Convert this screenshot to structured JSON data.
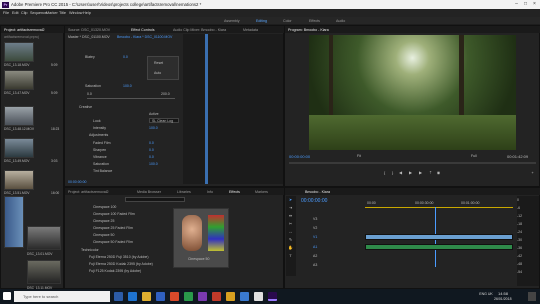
{
  "window": {
    "title": "Adobe Premiere Pro CC 2015 - C:\\Users\\user\\Videos\\projects college\\artifactsremoval\\nemations2 *"
  },
  "menu": [
    "File",
    "Edit",
    "Clip",
    "Sequence",
    "Marker",
    "Title",
    "Window",
    "Help"
  ],
  "workspaces": {
    "items": [
      "Assembly",
      "Editing",
      "Color",
      "Effects",
      "Audio"
    ],
    "active": "Editing"
  },
  "project": {
    "tab": "Project: artifactsremoval2",
    "tabs2": [
      "Media Br",
      "Info",
      "Libr"
    ],
    "path": "artifactsremoval.prproj",
    "clips": [
      {
        "name": "DSC_13.18.MOV",
        "dur": "5:09"
      },
      {
        "name": "DSC_13.47.MOV",
        "dur": "5:09"
      },
      {
        "name": "DSC_13.48.12.MOV",
        "dur": "18:23"
      },
      {
        "name": "DSC_13.49.MOV",
        "dur": "3:03"
      },
      {
        "name": "DSC_13.51.MOV",
        "dur": "16:00"
      },
      {
        "name": "DSC_13.01.MOV",
        "dur": "14:09"
      },
      {
        "name": "DSC_13.11.MOV",
        "dur": "5:01"
      }
    ]
  },
  "effect_controls": {
    "tabs": [
      "Source: DSC_01320.MOV",
      "Effect Controls",
      "Audio Clip Mixer: Bmoobo - Kiara",
      "Metadata"
    ],
    "master": "Master * DSC_01100.MOV",
    "clip": "Bmoobo - Kiara * DSC_01100.MOV",
    "menu_items": [
      "Reset",
      "Auto"
    ],
    "rows": [
      {
        "label": "Blatey",
        "value": "0.0"
      },
      {
        "label": "Saturation",
        "value": "100.0"
      },
      {
        "label": "0.0",
        "value": "200.0"
      },
      {
        "label": "Creative",
        "value": ""
      },
      {
        "label": "Look",
        "value": "SL Clean Log"
      },
      {
        "label": "Intensity",
        "value": "100.0"
      },
      {
        "label": "Adjustments",
        "value": ""
      },
      {
        "label": "Faded Film",
        "value": "0.0"
      },
      {
        "label": "Sharpen",
        "value": "0.0"
      },
      {
        "label": "Vibrance",
        "value": "0.0"
      },
      {
        "label": "Saturation",
        "value": "100.0"
      },
      {
        "label": "Tint Balance",
        "value": ""
      }
    ],
    "active_checkbox": "Active",
    "timecode": "00:00:00:00"
  },
  "program": {
    "title": "Program: Bmoobo - Kiara",
    "timecode": "00:00:00:00",
    "fit": "Fit",
    "quality": "Full",
    "duration": "00:01:42:09"
  },
  "effects": {
    "tabs": [
      "Project: artifactsremoval2",
      "Media Browser",
      "Libraries",
      "Info",
      "Effects",
      "Markers"
    ],
    "search": "",
    "items": [
      "Cinespace 100",
      "Cinespace 100 Faded Film",
      "Cinespace 25",
      "Cinespace 25 Faded Film",
      "Cinespace 50",
      "Cinespace 50 Faded Film",
      "Technicolor",
      "Fuji Eterna 250D Fuji 3510 (by Adobe)",
      "Fuji Eterna 250D Kodak 2395 (by Adobe)",
      "Fuji F125 Kodak 2395 (by Adobe)"
    ],
    "preview_label": "Cinespace 50"
  },
  "timeline": {
    "tab": "Bmoobo - Kiara",
    "timecode": "00:00:00:00",
    "ruler": [
      "00:00",
      "00:00:30:00",
      "00:01:00:00"
    ],
    "tracks": [
      "V3",
      "V2",
      "V1",
      "A1",
      "A2",
      "A3"
    ],
    "levels": [
      "0",
      "-6",
      "-12",
      "-18",
      "-24",
      "-30",
      "-36",
      "-42",
      "-48",
      "-54"
    ]
  },
  "taskbar": {
    "search_placeholder": "Type here to search",
    "time": "14:58",
    "date": "26/01/2018",
    "lang": "ENG UK"
  },
  "colors": {
    "accent": "#4b9cff",
    "audio": "#2f8a4a",
    "video": "#6a9fd0"
  }
}
